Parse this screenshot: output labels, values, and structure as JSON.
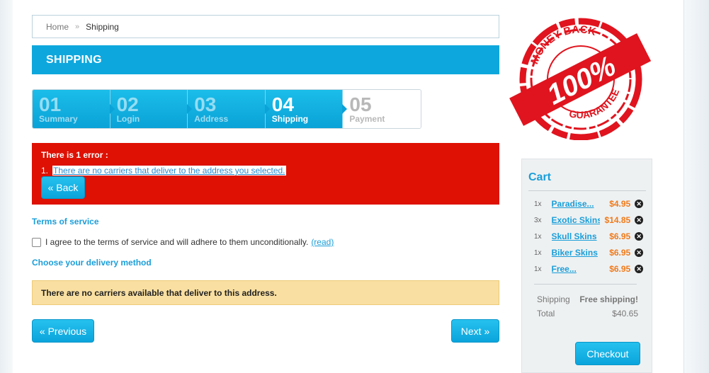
{
  "breadcrumb": {
    "home": "Home",
    "separator": "»",
    "current": "Shipping"
  },
  "heading": "SHIPPING",
  "steps": [
    {
      "num": "01",
      "label": "Summary",
      "state": "done"
    },
    {
      "num": "02",
      "label": "Login",
      "state": "done"
    },
    {
      "num": "03",
      "label": "Address",
      "state": "done"
    },
    {
      "num": "04",
      "label": "Shipping",
      "state": "current"
    },
    {
      "num": "05",
      "label": "Payment",
      "state": "todo"
    }
  ],
  "error": {
    "title": "There is 1 error :",
    "index": "1.",
    "message": "There are no carriers that deliver to the address you selected.",
    "back_label": "« Back"
  },
  "terms": {
    "title": "Terms of service",
    "agree_text": "I agree to the terms of service and will adhere to them unconditionally.",
    "read_link": "(read)",
    "checked": false
  },
  "delivery": {
    "title": "Choose your delivery method",
    "warning": "There are no carriers available that deliver to this address."
  },
  "nav": {
    "previous_label": "« Previous",
    "next_label": "Next »"
  },
  "stamp": {
    "top_text": "MONEY BACK",
    "center_text": "100%",
    "bottom_text": "GUARANTEE",
    "color": "#e0141e"
  },
  "cart": {
    "title": "Cart",
    "items": [
      {
        "qty": "1x",
        "name": "Paradise...",
        "price": "$4.95"
      },
      {
        "qty": "3x",
        "name": "Exotic Skins",
        "price": "$14.85"
      },
      {
        "qty": "1x",
        "name": "Skull Skins",
        "price": "$6.95"
      },
      {
        "qty": "1x",
        "name": "Biker Skins",
        "price": "$6.95"
      },
      {
        "qty": "1x",
        "name": "Free...",
        "price": "$6.95"
      }
    ],
    "shipping_label": "Shipping",
    "shipping_value": "Free shipping!",
    "total_label": "Total",
    "total_value": "$40.65",
    "checkout_label": "Checkout"
  },
  "colors": {
    "accent": "#0ea7dd",
    "error": "#de1104",
    "warning": "#f9dfa1",
    "price": "#f07a1b"
  }
}
